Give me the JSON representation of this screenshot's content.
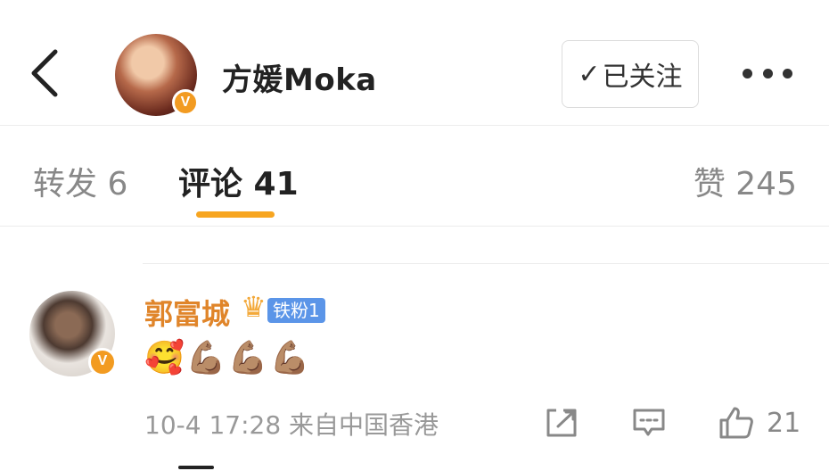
{
  "header": {
    "username": "方媛Moka",
    "verified_badge": "V",
    "follow_label": "已关注",
    "follow_icon": "check-icon",
    "more_icon": "more-dots-icon",
    "back_icon": "chevron-left-icon"
  },
  "tabs": {
    "repost": "转发 6",
    "comment": "评论 41",
    "like": "赞 245",
    "active": "comment",
    "accent_color": "#f7a520"
  },
  "comment": {
    "author": "郭富城",
    "author_color": "#e0852a",
    "verified_badge": "V",
    "fan_badge": "铁粉1",
    "crown_icon": "crown-icon",
    "text": "🥰💪🏽💪🏽💪🏽",
    "timestamp": "10-4 17:28",
    "source": "来自中国香港",
    "like_count": "21"
  }
}
